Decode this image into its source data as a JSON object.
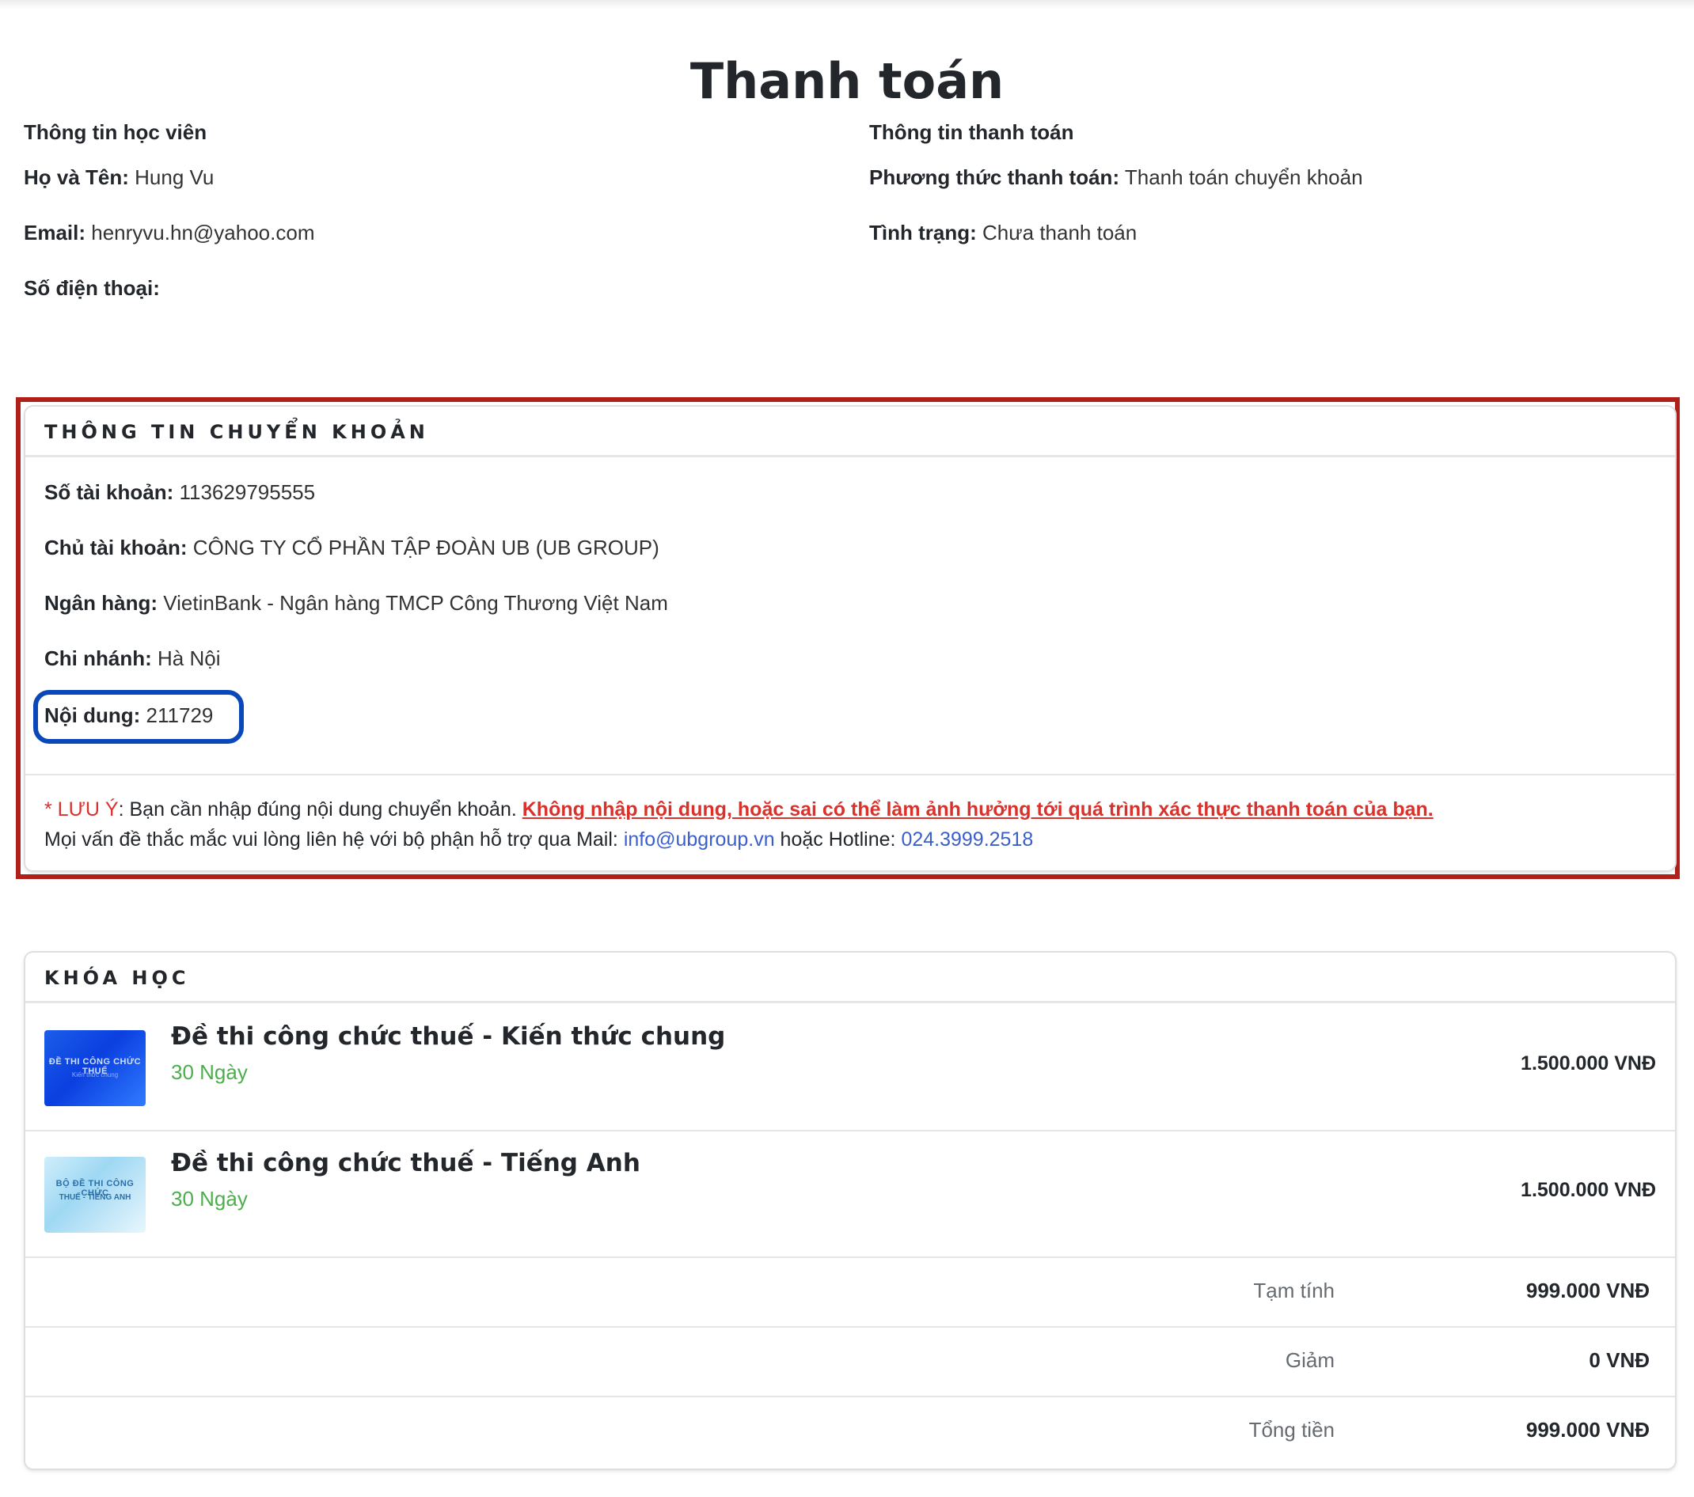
{
  "page": {
    "title": "Thanh toán"
  },
  "student": {
    "heading": "Thông tin học viên",
    "name_label": "Họ và Tên:",
    "name_value": "Hung Vu",
    "email_label": "Email:",
    "email_value": "henryvu.hn@yahoo.com",
    "phone_label": "Số điện thoại:",
    "phone_value": ""
  },
  "payment": {
    "heading": "Thông tin thanh toán",
    "method_label": "Phương thức thanh toán:",
    "method_value": "Thanh toán chuyển khoản",
    "status_label": "Tình trạng:",
    "status_value": "Chưa thanh toán"
  },
  "bank": {
    "heading": "THÔNG TIN CHUYỂN KHOẢN",
    "account_label": "Số tài khoản:",
    "account_value": "113629795555",
    "holder_label": "Chủ tài khoản:",
    "holder_value": "CÔNG TY CỔ PHẦN TẬP ĐOÀN UB (UB GROUP)",
    "bankname_label": "Ngân hàng:",
    "bankname_value": "VietinBank - Ngân hàng TMCP Công Thương Việt Nam",
    "branch_label": "Chi nhánh:",
    "branch_value": "Hà Nội",
    "content_label": "Nội dung:",
    "content_value": "211729",
    "note_star": "* LƯU Ý",
    "note_text": ": Bạn cần nhập đúng nội dung chuyển khoản. ",
    "note_warning": "Không nhập nội dung, hoặc sai có thể làm ảnh hưởng tới quá trình xác thực thanh toán của bạn.",
    "support_text": "Mọi vấn đề thắc mắc vui lòng liên hệ với bộ phận hỗ trợ qua Mail: ",
    "support_email": "info@ubgroup.vn",
    "support_or": " hoặc Hotline: ",
    "support_hotline": "024.3999.2518"
  },
  "courses": {
    "heading": "KHÓA HỌC",
    "items": [
      {
        "name": "Đề thi công chức thuế - Kiến thức chung",
        "duration": "30 Ngày",
        "price": "1.500.000 VNĐ",
        "thumb_line1": "ĐỀ THI CÔNG CHỨC THUẾ",
        "thumb_line2": "Kiến thức chung"
      },
      {
        "name": "Đề thi công chức thuế - Tiếng Anh",
        "duration": "30 Ngày",
        "price": "1.500.000 VNĐ",
        "thumb_line1": "BỘ ĐỀ THI CÔNG CHỨC",
        "thumb_line2": "THUẾ - TIẾNG ANH"
      }
    ],
    "subtotal_label": "Tạm tính",
    "subtotal_value": "999.000 VNĐ",
    "discount_label": "Giảm",
    "discount_value": "0 VNĐ",
    "total_label": "Tổng tiền",
    "total_value": "999.000 VNĐ"
  },
  "colors": {
    "highlight_frame": "#b0201b",
    "content_highlight": "#0a47b8",
    "warning": "#d9312b",
    "link": "#3a5fcd",
    "duration": "#4cae4c"
  }
}
